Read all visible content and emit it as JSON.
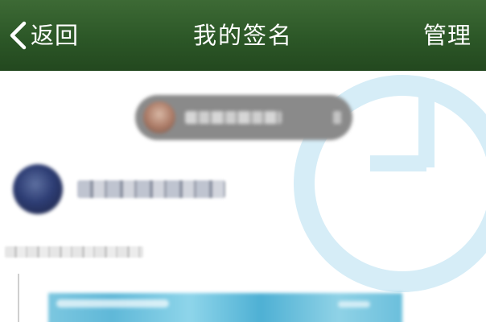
{
  "nav": {
    "back_label": "返回",
    "title": "我的签名",
    "manage_label": "管理"
  },
  "icons": {
    "back": "chevron-left-icon",
    "watermark": "clock-icon"
  },
  "colors": {
    "navbar_green": "#2c5727",
    "navbar_text": "#ffffff",
    "watermark_blue": "#d3ecf6",
    "background": "#ffffff"
  }
}
